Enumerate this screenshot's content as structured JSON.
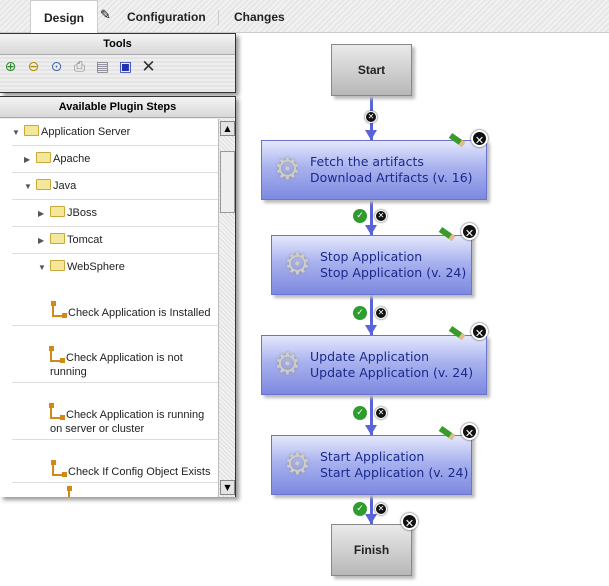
{
  "tabs": [
    {
      "label": "Design",
      "active": true
    },
    {
      "label": "Configuration",
      "icon": "pencil-icon"
    },
    {
      "label": "Changes"
    }
  ],
  "tools_panel": {
    "title": "Tools",
    "buttons": [
      "zoom-in-icon",
      "zoom-out-icon",
      "zoom-reset-icon",
      "print-icon",
      "print-preview-icon",
      "save-icon",
      "close-icon"
    ]
  },
  "plugin_panel": {
    "title": "Available Plugin Steps",
    "folders": [
      {
        "label": "Application Server",
        "expanded": true
      },
      {
        "label": "Apache",
        "expanded": false
      },
      {
        "label": "Java",
        "expanded": true
      },
      {
        "label": "JBoss",
        "expanded": false
      },
      {
        "label": "Tomcat",
        "expanded": false
      },
      {
        "label": "WebSphere",
        "expanded": true
      }
    ],
    "steps": [
      {
        "line1": "Check Application is Installed",
        "line2": ""
      },
      {
        "line1": "Check Application is not",
        "line2": "running"
      },
      {
        "line1": "Check Application is running",
        "line2": "on server or cluster"
      },
      {
        "line1": "Check If Config Object Exists",
        "line2": ""
      }
    ]
  },
  "process": {
    "start": "Start",
    "finish": "Finish",
    "steps": [
      {
        "name": "Fetch the artifacts",
        "step": "Download Artifacts (v. 16)"
      },
      {
        "name": "Stop Application",
        "step": "Stop Application (v. 24)"
      },
      {
        "name": "Update Application",
        "step": "Update Application (v. 24)"
      },
      {
        "name": "Start Application",
        "step": "Start Application (v. 24)"
      }
    ]
  },
  "colors": {
    "node": "#8f9ae6",
    "connector": "#5a63d8",
    "node_text": "#1a2a8c"
  }
}
